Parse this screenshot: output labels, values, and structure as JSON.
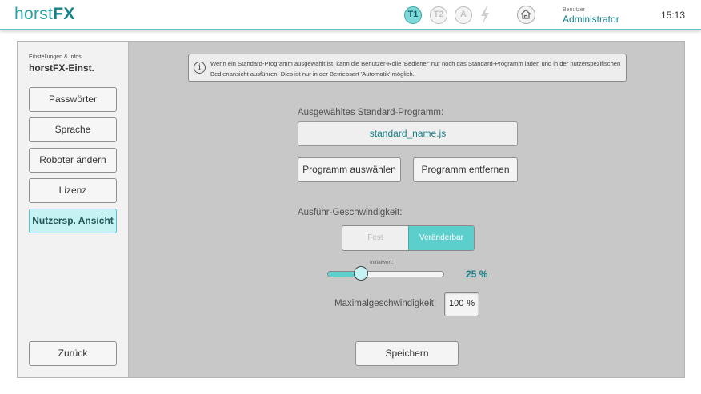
{
  "header": {
    "logo_light": "horst",
    "logo_bold": "FX",
    "mode_buttons": [
      {
        "label": "T1",
        "active": true
      },
      {
        "label": "T2",
        "active": false
      },
      {
        "label": "A",
        "active": false
      }
    ],
    "user_caption": "Benutzer",
    "user_name": "Administrator",
    "time": "15:13"
  },
  "sidebar": {
    "caption": "Einstellungen & Infos",
    "title": "horstFX-Einst.",
    "items": [
      {
        "label": "Passwörter",
        "active": false
      },
      {
        "label": "Sprache",
        "active": false
      },
      {
        "label": "Roboter ändern",
        "active": false
      },
      {
        "label": "Lizenz",
        "active": false
      },
      {
        "label": "Nutzersp. Ansicht",
        "active": true
      }
    ],
    "back_label": "Zurück"
  },
  "main": {
    "info_text": "Wenn ein Standard-Programm ausgewählt ist, kann die Benutzer-Rolle 'Bediener' nur noch das Standard-Programm laden und in der nutzerspezifischen Bedienansicht ausführen. Dies ist nur in der Betriebsart 'Automatik' möglich.",
    "program_label": "Ausgewähltes Standard-Programm:",
    "program_value": "standard_name.js",
    "select_button": "Programm auswählen",
    "remove_button": "Programm entfernen",
    "speed_label": "Ausführ-Geschwindigkeit:",
    "speed_options": [
      "Fest",
      "Veränderbar"
    ],
    "speed_selected": "Veränderbar",
    "slider_caption": "Initialwert:",
    "slider_value": 25,
    "slider_value_text": "25 %",
    "max_label": "Maximalgeschwindigkeit:",
    "max_value": "100",
    "max_unit": "%",
    "save_button": "Speichern"
  },
  "colors": {
    "accent": "#5ccfcd",
    "accent_text": "#16808a",
    "active_item_bg": "#c6f2f4"
  }
}
